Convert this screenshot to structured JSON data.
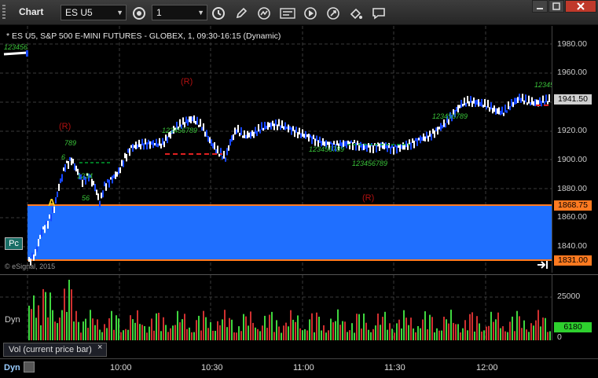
{
  "window": {
    "title": "Chart"
  },
  "toolbar": {
    "symbol": "ES U5",
    "interval": "1"
  },
  "chart": {
    "title": "* ES U5, S&P 500 E-MINI FUTURES - GLOBEX, 1, 09:30-16:15 (Dynamic)",
    "copyright": "© eSignal, 2015",
    "badge": "Pc",
    "marker_a": "A",
    "r_labels": [
      "(R)",
      "(R)",
      "(R)"
    ],
    "price_axis": {
      "ticks": [
        "1980.00",
        "1960.00",
        "1940.00",
        "1920.00",
        "1900.00",
        "1880.00",
        "1860.00",
        "1840.00"
      ],
      "last_price": "1941.50",
      "zone_top": "1868.75",
      "zone_bottom": "1831.00"
    },
    "time_axis": {
      "ticks": [
        "10:00",
        "10:30",
        "11:00",
        "11:30",
        "12:00"
      ]
    }
  },
  "volume": {
    "axis_ticks": [
      "25000",
      "0"
    ],
    "current": "6180",
    "tab_label": "Vol (current price bar)",
    "tab_close": "×"
  },
  "footer": {
    "dyn_label": "Dyn"
  },
  "sidebar": {
    "dyn_label": "Dyn"
  },
  "colors": {
    "zone": "#1f6fff",
    "up": "#ffffff",
    "down": "#1646ff",
    "current": "#00c040",
    "zone_edge": "#ff7a20",
    "resistance": "#b01010"
  }
}
